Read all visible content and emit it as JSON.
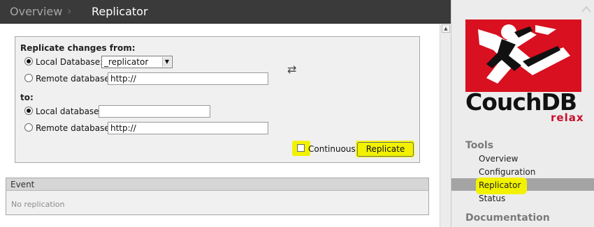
{
  "header": {
    "breadcrumb_overview": "Overview",
    "breadcrumb_separator": "›",
    "breadcrumb_current": "Replicator"
  },
  "form": {
    "from_label": "Replicate changes from:",
    "to_label": "to:",
    "from_local_label": "Local Database:",
    "from_local_selected": "_replicator",
    "from_remote_label": "Remote database:",
    "from_remote_value": "http://",
    "to_local_label": "Local database:",
    "to_local_value": "",
    "to_remote_label": "Remote database:",
    "to_remote_value": "http://",
    "swap_glyph": "⇄",
    "continuous_label": "Continuous",
    "replicate_button": "Replicate"
  },
  "events": {
    "header": "Event",
    "empty_text": "No replication"
  },
  "sidebar": {
    "logo_text": "CouchDB",
    "logo_sub": "relax",
    "tools_heading": "Tools",
    "items": [
      {
        "label": "Overview"
      },
      {
        "label": "Configuration"
      },
      {
        "label": "Replicator"
      },
      {
        "label": "Status"
      }
    ],
    "documentation_heading": "Documentation"
  },
  "colors": {
    "header_bg": "#3a3a3a",
    "highlight": "#f2f200",
    "brand_red": "#c8102e",
    "sidebar_bg": "#ececec"
  }
}
